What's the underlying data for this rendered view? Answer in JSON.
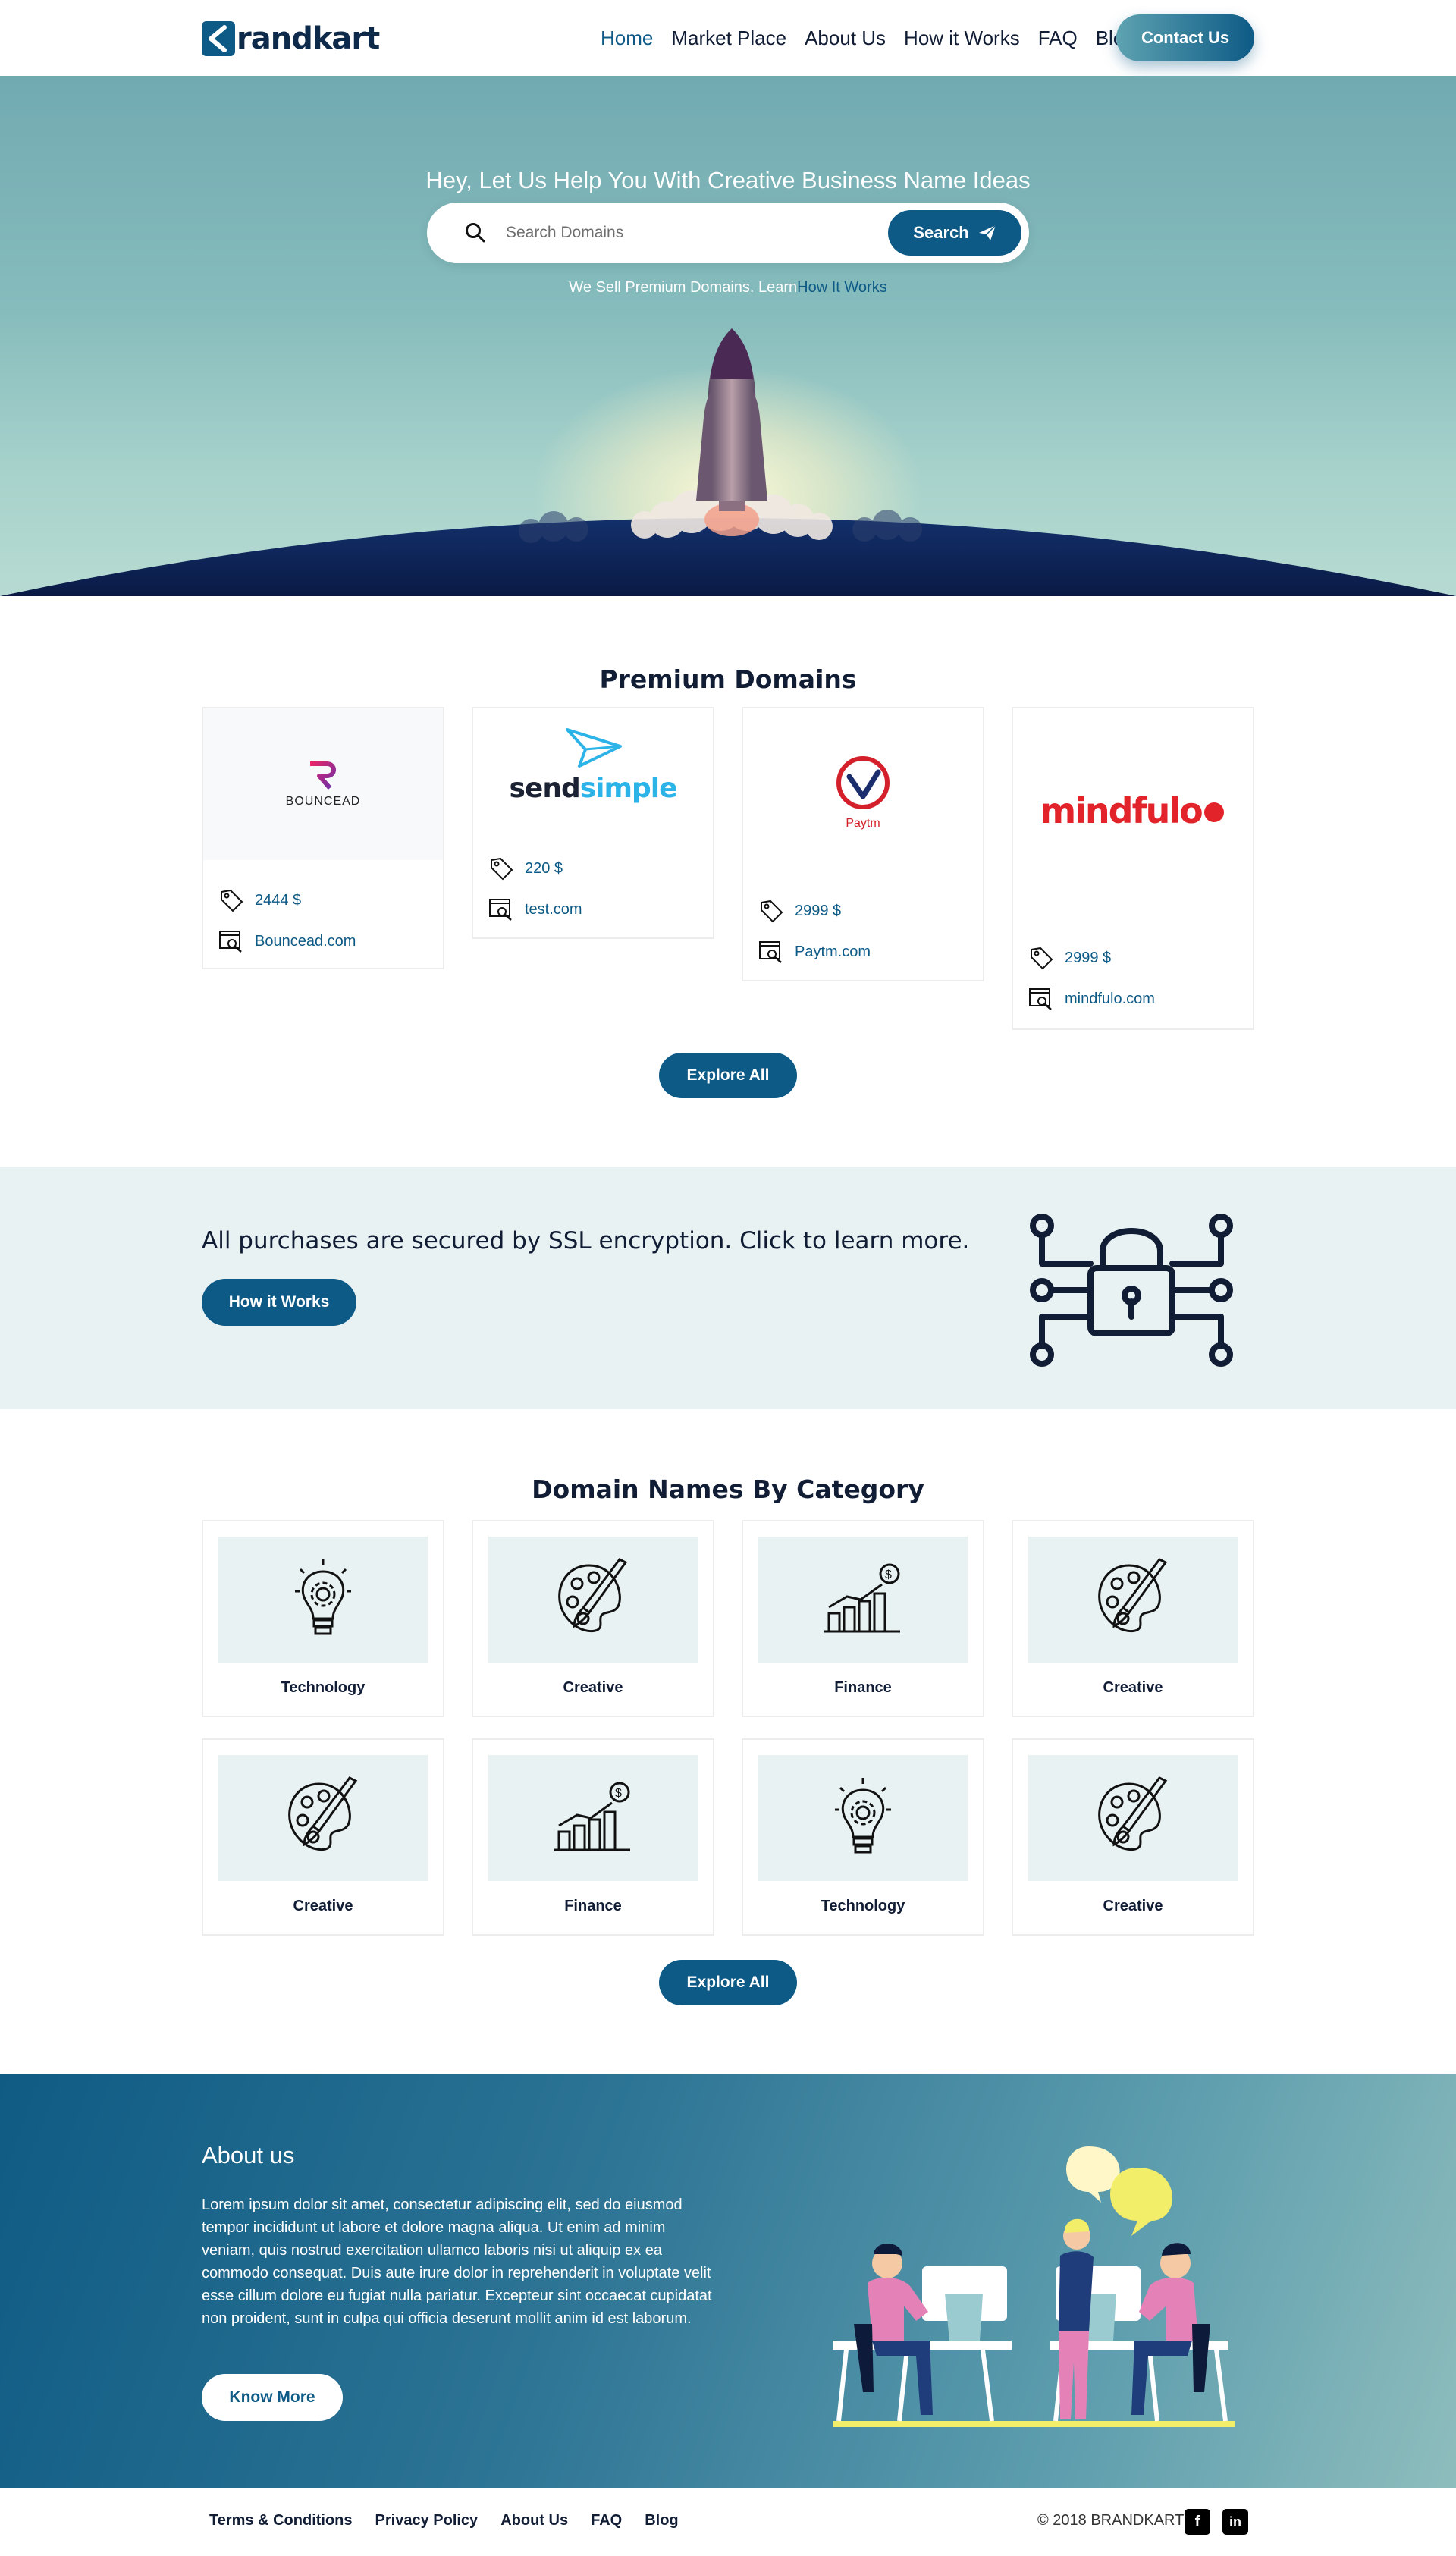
{
  "brand": {
    "name": "randkart",
    "mark_letter": "B"
  },
  "nav": {
    "items": [
      "Home",
      "Market Place",
      "About Us",
      "How it Works",
      "FAQ",
      "Blog"
    ],
    "contact_label": "Contact Us"
  },
  "hero": {
    "title": "Hey, Let Us Help You With Creative Business Name Ideas",
    "search_placeholder": "Search Domains",
    "search_label": "Search",
    "sub_prefix": "We Sell Premium Domains. Learn",
    "sub_link": "How It Works"
  },
  "premium": {
    "title": "Premium Domains",
    "cards": [
      {
        "logo": "BOUNCEAD",
        "price": "2444 $",
        "domain": "Bouncead.com"
      },
      {
        "logo": "sendsimple",
        "price": "220 $",
        "domain": "test.com"
      },
      {
        "logo": "Paytm",
        "price": "2999 $",
        "domain": "Paytm.com"
      },
      {
        "logo": "mindfulo",
        "price": "2999 $",
        "domain": "mindfulo.com"
      }
    ],
    "explore_label": "Explore All"
  },
  "ssl": {
    "text": "All purchases are secured by SSL encryption. Click to learn more.",
    "button": "How it Works"
  },
  "categories": {
    "title": "Domain Names By Category",
    "items": [
      {
        "label": "Technology",
        "icon": "lightbulb-gear-icon"
      },
      {
        "label": "Creative",
        "icon": "palette-brush-icon"
      },
      {
        "label": "Finance",
        "icon": "bar-chart-dollar-icon"
      },
      {
        "label": "Creative",
        "icon": "palette-brush-icon"
      },
      {
        "label": "Creative",
        "icon": "palette-brush-icon"
      },
      {
        "label": "Finance",
        "icon": "bar-chart-dollar-icon"
      },
      {
        "label": "Technology",
        "icon": "lightbulb-gear-icon"
      },
      {
        "label": "Creative",
        "icon": "palette-brush-icon"
      }
    ],
    "explore_label": "Explore All"
  },
  "about": {
    "title": "About us",
    "body": "Lorem ipsum dolor sit amet, consectetur adipiscing elit, sed do eiusmod tempor incididunt ut labore et dolore magna aliqua. Ut enim ad minim veniam, quis nostrud exercitation ullamco laboris nisi ut aliquip ex ea commodo consequat. Duis aute irure dolor in reprehenderit in voluptate velit esse cillum dolore eu fugiat nulla pariatur. Excepteur sint occaecat cupidatat non proident, sunt in culpa qui officia deserunt mollit anim id est laborum.",
    "button": "Know More"
  },
  "footer": {
    "links": [
      "Terms & Conditions",
      "Privacy Policy",
      "About Us",
      "FAQ",
      "Blog"
    ],
    "copyright": "© 2018 BRANDKART",
    "social": [
      "facebook-icon",
      "linkedin-icon"
    ]
  },
  "colors": {
    "primary": "#0d5a86",
    "dark": "#111d35",
    "light_bg": "#e9f2f3"
  }
}
